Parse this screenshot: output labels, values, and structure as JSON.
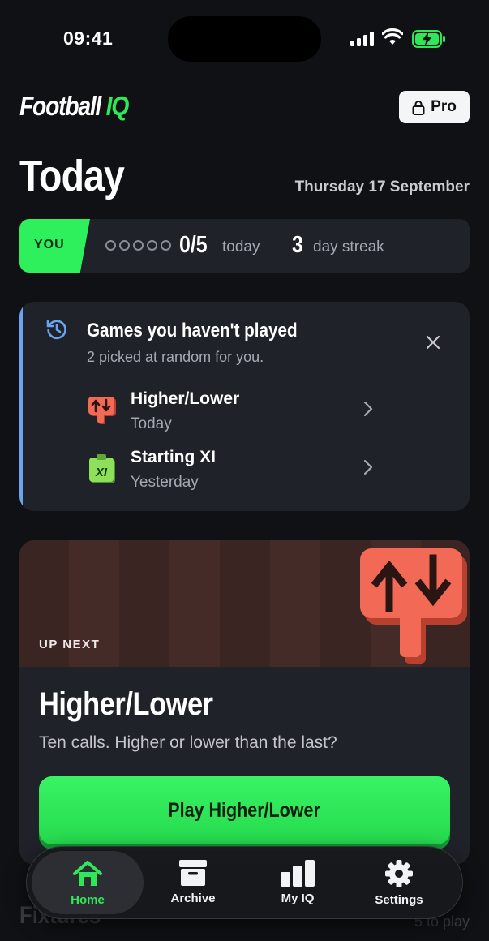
{
  "status_bar": {
    "time": "09:41"
  },
  "header": {
    "logo_main": "Football",
    "logo_accent": "IQ",
    "pro_label": "Pro"
  },
  "today": {
    "title": "Today",
    "date": "Thursday 17 September"
  },
  "progress": {
    "you_label": "YOU",
    "completed": 0,
    "total": 5,
    "score": "0/5",
    "score_suffix": "today",
    "streak_count": "3",
    "streak_suffix": "day streak"
  },
  "missed_games": {
    "title": "Games you haven't played",
    "subtitle": "2 picked at random for you.",
    "items": [
      {
        "name": "Higher/Lower",
        "when": "Today",
        "icon": "higher-lower-icon"
      },
      {
        "name": "Starting XI",
        "when": "Yesterday",
        "icon": "starting-xi-icon"
      }
    ]
  },
  "up_next": {
    "label": "UP NEXT",
    "title": "Higher/Lower",
    "description": "Ten calls. Higher or lower than the last?",
    "play_label": "Play Higher/Lower"
  },
  "below_fold": {
    "section_title": "Fixtures",
    "count_text": "5 to play"
  },
  "tabbar": {
    "items": [
      {
        "label": "Home",
        "icon": "home-icon",
        "active": true
      },
      {
        "label": "Archive",
        "icon": "archive-icon",
        "active": false
      },
      {
        "label": "My IQ",
        "icon": "bar-chart-icon",
        "active": false
      },
      {
        "label": "Settings",
        "icon": "gear-icon",
        "active": false
      }
    ]
  },
  "colors": {
    "background": "#101114",
    "card": "#1f2229",
    "accent_green": "#2ee858",
    "accent_blue": "#6aa3f0",
    "higher_lower_red": "#f26a55"
  }
}
